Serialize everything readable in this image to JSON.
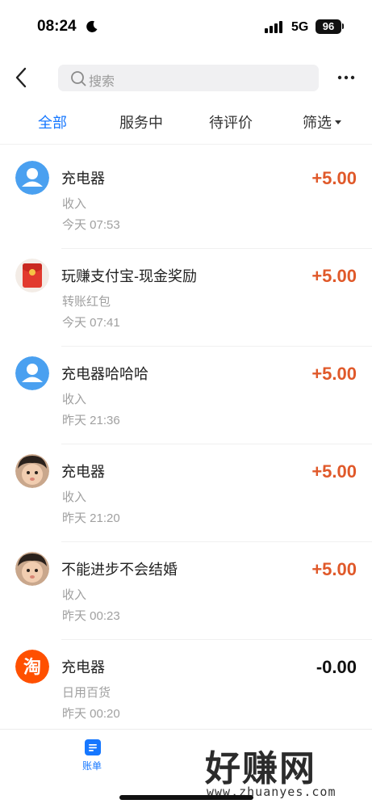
{
  "status_bar": {
    "time": "08:24",
    "network": "5G",
    "battery": "96"
  },
  "header": {
    "search_placeholder": "搜索"
  },
  "tabs": [
    {
      "label": "全部",
      "active": true
    },
    {
      "label": "服务中",
      "active": false
    },
    {
      "label": "待评价",
      "active": false
    },
    {
      "label": "筛选",
      "active": false
    }
  ],
  "transactions": [
    {
      "title": "充电器",
      "type": "收入",
      "time": "今天  07:53",
      "amount": "+5.00",
      "avatar": "default-user-icon"
    },
    {
      "title": "玩赚支付宝-现金奖励",
      "type": "转账红包",
      "time": "今天  07:41",
      "amount": "+5.00",
      "avatar": "red-envelope-icon"
    },
    {
      "title": "充电器哈哈哈",
      "type": "收入",
      "time": "昨天  21:36",
      "amount": "+5.00",
      "avatar": "default-user-icon"
    },
    {
      "title": "充电器",
      "type": "收入",
      "time": "昨天  21:20",
      "amount": "+5.00",
      "avatar": "child-photo"
    },
    {
      "title": "不能进步不会结婚",
      "type": "收入",
      "time": "昨天  00:23",
      "amount": "+5.00",
      "avatar": "child-photo"
    },
    {
      "title": "充电器",
      "type": "日用百货",
      "time": "昨天  00:20",
      "amount": "-0.00",
      "avatar": "taobao-icon"
    }
  ],
  "bottom_bar": {
    "bill_label": "账单"
  },
  "watermark": {
    "main": "好赚网",
    "sub": "www.zhuanyes.com"
  },
  "colors": {
    "accent": "#1677ff",
    "income": "#e0592a",
    "taobao": "#ff5000"
  }
}
